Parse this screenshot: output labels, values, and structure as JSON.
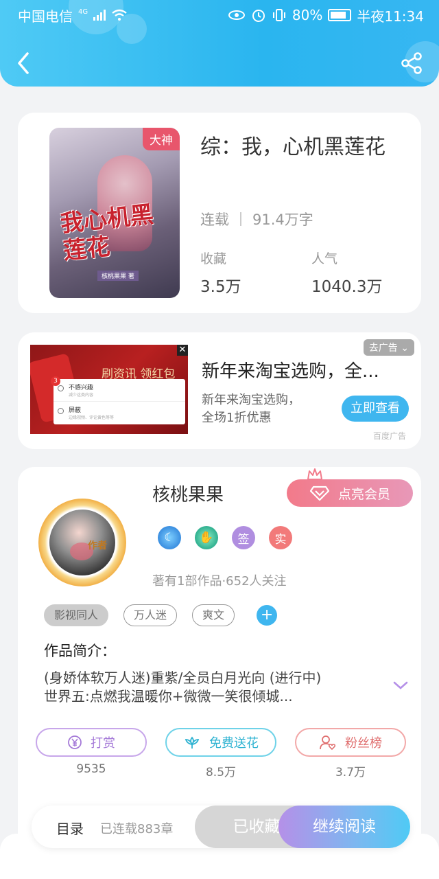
{
  "status_bar": {
    "carrier": "中国电信",
    "network": "4G",
    "battery": "80%",
    "time": "半夜11:34"
  },
  "header": {
    "back_icon": "chevron-left-icon",
    "share_icon": "share-icon"
  },
  "book": {
    "badge": "大神",
    "title": "综：我，心机黑莲花",
    "cover_text": "我心机黑莲花",
    "cover_author": "核桃果果 著",
    "status": "连载",
    "word_count": "91.4万字",
    "favorites_label": "收藏",
    "favorites_value": "3.5万",
    "popularity_label": "人气",
    "popularity_value": "1040.3万"
  },
  "ad": {
    "image_text": "刷资讯 领红包",
    "popup_num": "3",
    "popup_row1": "不感兴趣",
    "popup_row1_sub": "减少这类内容",
    "popup_row2": "屏蔽",
    "popup_row2_sub": "边缘视频、评论黄色等等",
    "remove_label": "去广告",
    "title": "新年来淘宝选购，全...",
    "desc_line1": "新年来淘宝选购，",
    "desc_line2": "全场1折优惠",
    "button": "立即查看",
    "source": "百度广告"
  },
  "author": {
    "role_tag": "作者",
    "name": "核桃果果",
    "vip_button": "点亮会员",
    "medal3": "签",
    "medal4": "实",
    "stats": "著有1部作品·652人关注",
    "tags": [
      "影视同人",
      "万人迷",
      "爽文"
    ],
    "add_tag": "+",
    "intro_heading": "作品简介：",
    "intro_line1": "(身娇体软万人迷)重紫/全员白月光向 (进行中)",
    "intro_line2": "世界五:点燃我温暖你+微微一笑很倾城..."
  },
  "actions": {
    "reward_label": "打赏",
    "reward_count": "9535",
    "flower_label": "免费送花",
    "flower_count": "8.5万",
    "fans_label": "粉丝榜",
    "fans_count": "3.7万"
  },
  "bottom_bar": {
    "toc": "目录",
    "chapters": "已连载883章",
    "favorited": "已收藏",
    "continue": "继续阅读"
  },
  "colors": {
    "accent": "#3fb6ef",
    "header": "#2ab5ef",
    "badge": "#e8566c"
  }
}
